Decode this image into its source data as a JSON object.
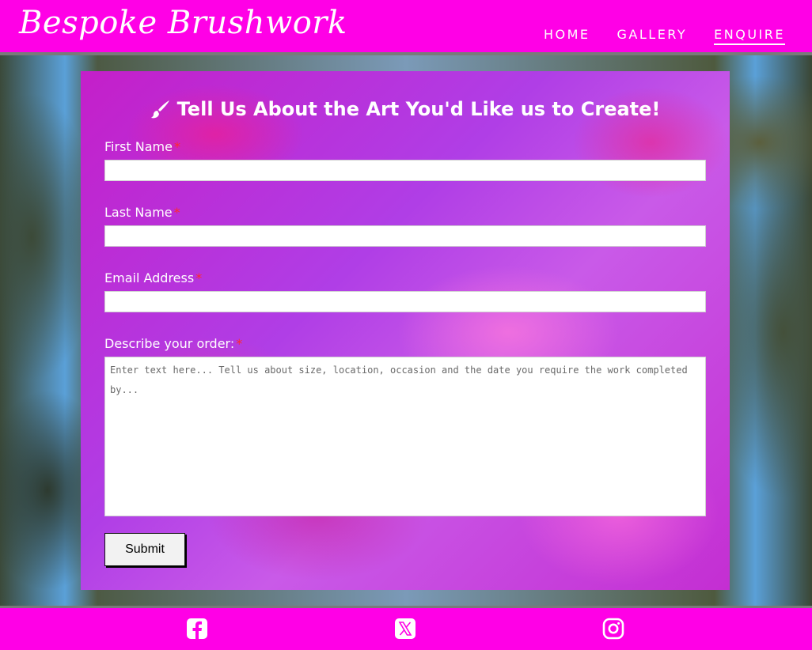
{
  "brand": {
    "name": "Bespoke Brushwork"
  },
  "nav": {
    "items": [
      {
        "label": "HOME"
      },
      {
        "label": "GALLERY"
      },
      {
        "label": "ENQUIRE",
        "active": true
      }
    ]
  },
  "form": {
    "title": "Tell Us About the Art You'd Like us to Create!",
    "title_icon": "paintbrush-icon",
    "fields": {
      "first_name": {
        "label": "First Name",
        "required_mark": "*",
        "value": ""
      },
      "last_name": {
        "label": "Last Name",
        "required_mark": "*",
        "value": ""
      },
      "email": {
        "label": "Email Address",
        "required_mark": "*",
        "value": ""
      },
      "order": {
        "label": "Describe your order:",
        "required_mark": "*",
        "placeholder": "Enter text here... Tell us about size, location, occasion and the date you require the work completed by...",
        "value": ""
      }
    },
    "submit_label": "Submit"
  },
  "footer": {
    "social": [
      "facebook-icon",
      "x-icon",
      "instagram-icon"
    ]
  },
  "colors": {
    "brand_pink": "#ff00e6",
    "required_red": "#ff2a2a"
  }
}
